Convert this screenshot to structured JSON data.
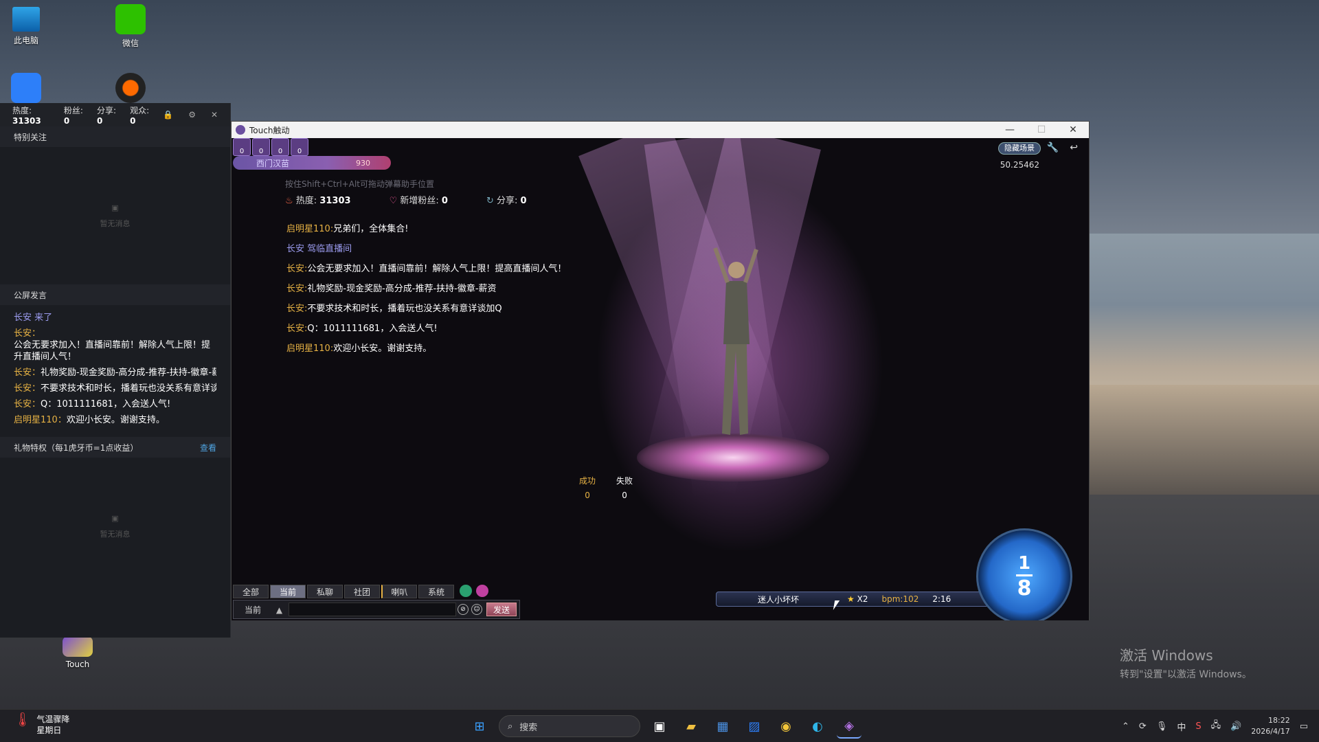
{
  "desktop": {
    "icons": [
      {
        "label": "此电脑"
      },
      {
        "label": "微信"
      },
      {
        "label": "Touch"
      }
    ]
  },
  "left_panel": {
    "heat_label": "热度:",
    "heat_value": "31303",
    "fans_label": "粉丝:",
    "fans_value": "0",
    "share_label": "分享:",
    "share_value": "0",
    "viewers_label": "观众:",
    "viewers_value": "0",
    "special_follow": "特别关注",
    "empty_text": "暂无消息",
    "public_chat": "公屏发言",
    "chat": [
      {
        "name": "长安 来了",
        "text": ""
      },
      {
        "name": "长安：",
        "text": "公会无要求加入！直播间靠前！解除人气上限！提升直播间人气！"
      },
      {
        "name": "长安：",
        "text": "礼物奖励-现金奖励-高分成-推荐-扶持-徽章-薪资"
      },
      {
        "name": "长安：",
        "text": "不要求技术和时长，播着玩也没关系有意详谈加Q"
      },
      {
        "name": "长安：",
        "text": "Q：1011111681，入会送人气!"
      },
      {
        "name": "启明星110：",
        "text": "欢迎小长安。谢谢支持。"
      }
    ],
    "gift_privilege": "礼物特权（每1虎牙币=1点收益）",
    "view_more": "查看",
    "empty_text2": "暂无消息"
  },
  "app": {
    "title": "Touch触动",
    "controls": {
      "minimize": "—",
      "maximize": "☐",
      "close": "✕"
    },
    "badges": [
      "0",
      "0",
      "0",
      "0"
    ],
    "user_name": "西门汉苗",
    "user_level": "930",
    "hide_scene": "隐藏场景",
    "coords": "50.25462",
    "hint": "按住Shift+Ctrl+Alt可拖动弹幕助手位置",
    "stats": {
      "heat_label": "热度:",
      "heat_value": "31303",
      "newfans_label": "新增粉丝:",
      "newfans_value": "0",
      "share_label": "分享:",
      "share_value": "0"
    },
    "chat": [
      {
        "name": "启明星110:",
        "text": "兄弟们，全体集合!",
        "nameColor": "#e7b244"
      },
      {
        "name": "长安 驾临直播间",
        "text": "",
        "nameColor": "#9c9cf0"
      },
      {
        "name": "长安:",
        "text": "公会无要求加入！直播间靠前！解除人气上限！提高直播间人气！",
        "nameColor": "#e7b244"
      },
      {
        "name": "长安:",
        "text": "礼物奖励-现金奖励-高分成-推荐-扶持-徽章-薪资",
        "nameColor": "#e7b244"
      },
      {
        "name": "长安:",
        "text": "不要求技术和时长，播着玩也没关系有意详谈加Q",
        "nameColor": "#e7b244"
      },
      {
        "name": "长安:",
        "text": "Q：1011111681，入会送人气!",
        "nameColor": "#e7b244"
      },
      {
        "name": "启明星110:",
        "text": "欢迎小长安。谢谢支持。",
        "nameColor": "#e7b244"
      }
    ],
    "success_label": "成功",
    "success_value": "0",
    "fail_label": "失败",
    "fail_value": "0",
    "song": {
      "name": "迷人小坏坏",
      "multiplier": "X2",
      "bpm": "bpm:102",
      "time": "2:16"
    },
    "beat": {
      "numerator": "1",
      "denominator": "8"
    },
    "tabs": [
      "全部",
      "当前",
      "私聊",
      "社团",
      "喇叭",
      "系统"
    ],
    "active_tab": "当前",
    "channel": "当前",
    "message_placeholder": "",
    "send": "发送"
  },
  "watermark": {
    "title": "激活 Windows",
    "subtitle": "转到\"设置\"以激活 Windows。"
  },
  "taskbar": {
    "weather_line1": "气温骤降",
    "weather_line2": "星期日",
    "search": "搜索",
    "time": "18:22",
    "date": "2026/4/17"
  }
}
